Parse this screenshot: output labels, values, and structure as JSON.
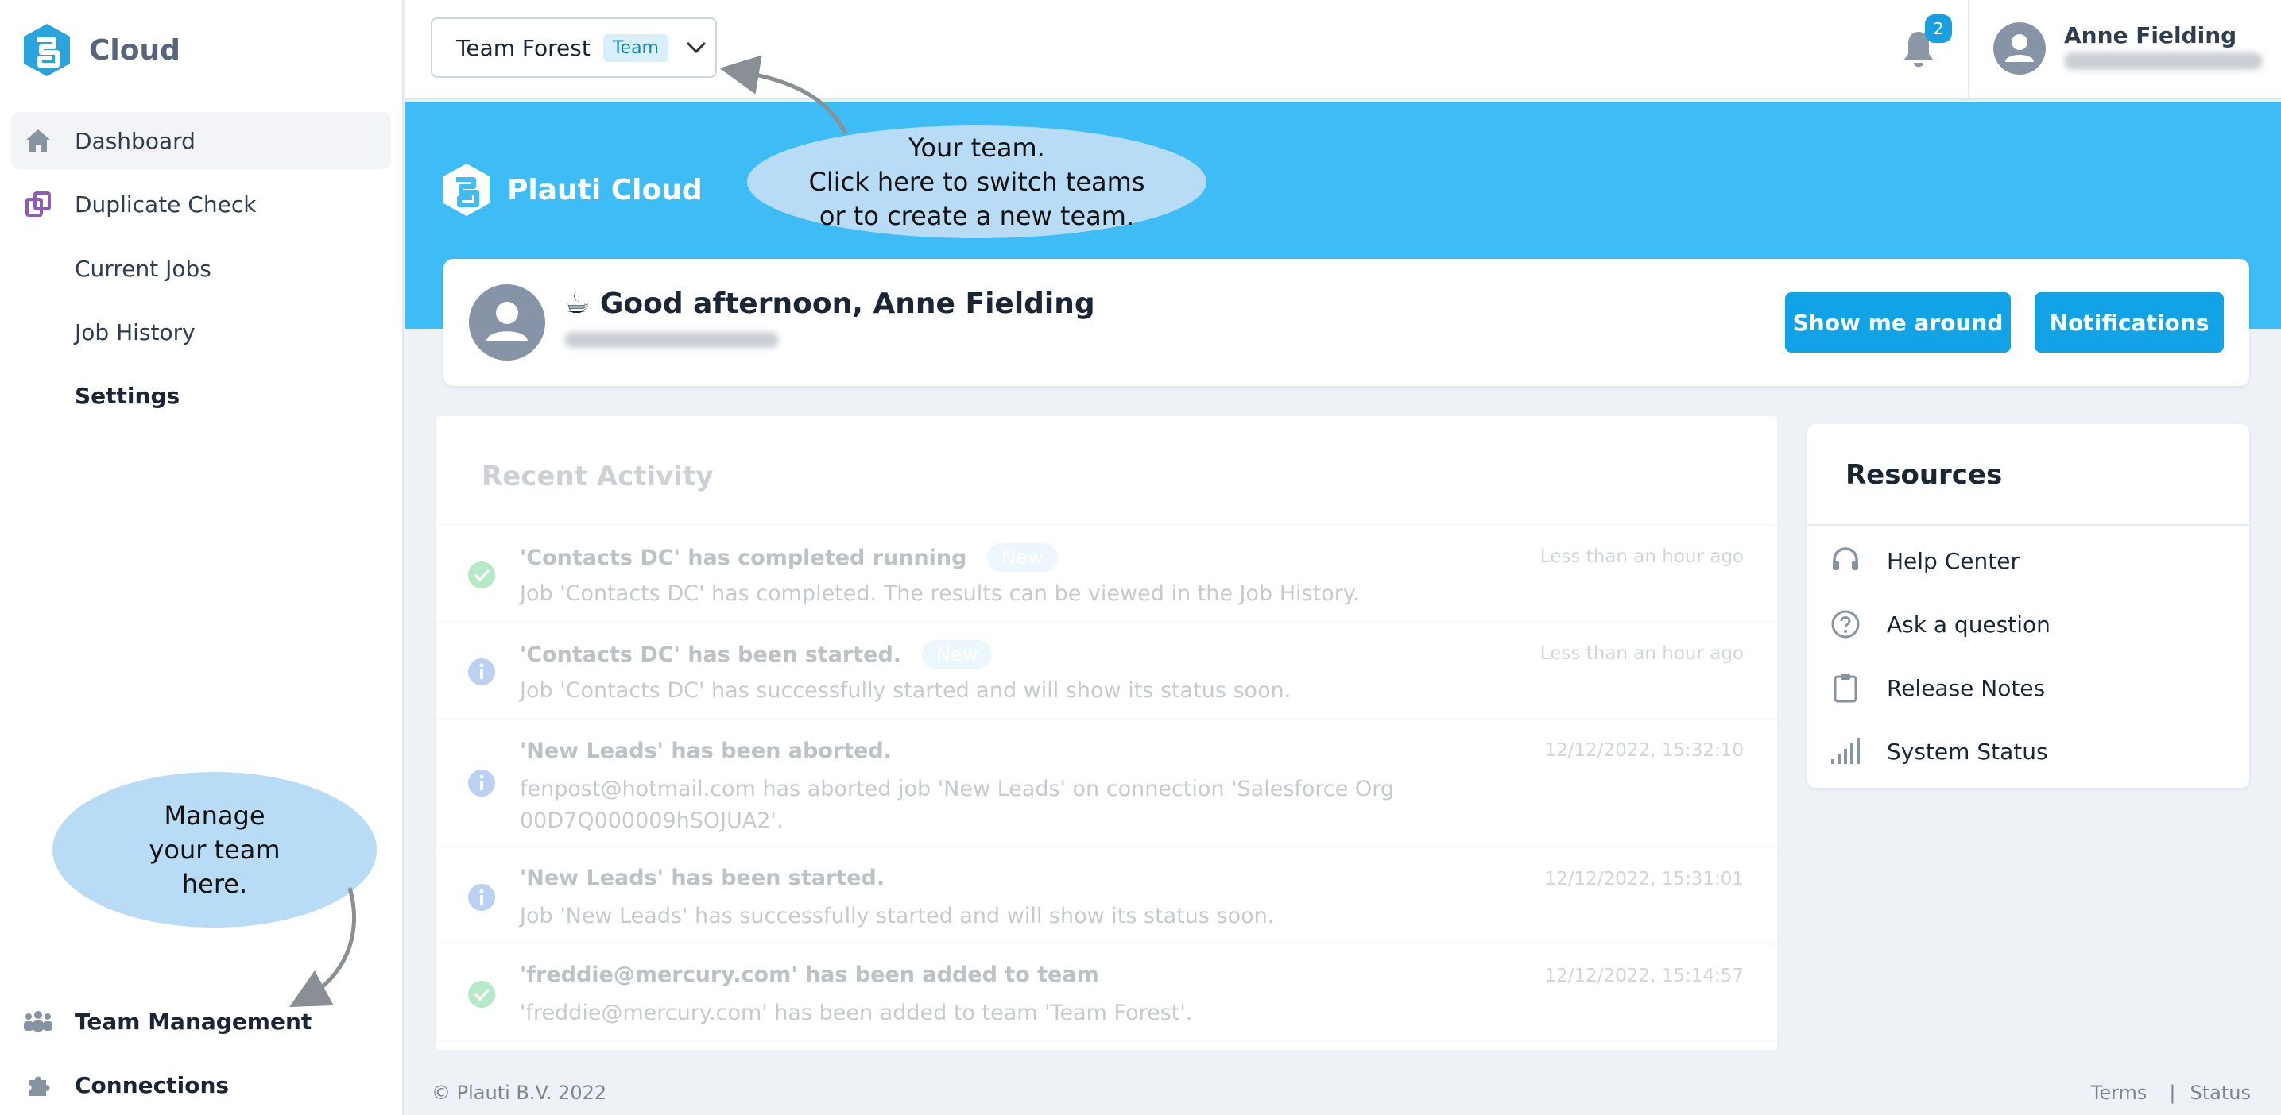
{
  "sidebar": {
    "brand": "Cloud",
    "nav": [
      {
        "label": "Dashboard",
        "icon": "home-icon",
        "active": true
      },
      {
        "label": "Duplicate Check",
        "icon": "duplicate-check-icon"
      }
    ],
    "sub_items": [
      {
        "label": "Current Jobs"
      },
      {
        "label": "Job History"
      },
      {
        "label": "Settings"
      }
    ],
    "bottom": [
      {
        "label": "Team Management",
        "icon": "team-icon"
      },
      {
        "label": "Connections",
        "icon": "puzzle-icon"
      }
    ]
  },
  "topbar": {
    "team_name": "Team Forest",
    "team_badge": "Team",
    "notification_count": "2",
    "user_name": "Anne Fielding"
  },
  "hero": {
    "brand": "Plauti Cloud"
  },
  "greeting": {
    "emoji": "☕",
    "text": "Good afternoon, Anne Fielding",
    "show_me_around": "Show me around",
    "notifications": "Notifications"
  },
  "activity": {
    "title": "Recent Activity",
    "items": [
      {
        "status": "success",
        "title": "'Contacts DC' has completed running",
        "badge": "New",
        "body": "Job 'Contacts DC' has completed. The results can be viewed in the Job History.",
        "time": "Less than an hour ago"
      },
      {
        "status": "info",
        "title": "'Contacts DC' has been started.",
        "badge": "New",
        "body": "Job 'Contacts DC' has successfully started and will show its status soon.",
        "time": "Less than an hour ago"
      },
      {
        "status": "info",
        "title": "'New Leads' has been aborted.",
        "badge": "",
        "body": "fenpost@hotmail.com has aborted job 'New Leads' on connection 'Salesforce Org 00D7Q000009hSOJUA2'.",
        "time": "12/12/2022, 15:32:10"
      },
      {
        "status": "info",
        "title": "'New Leads' has been started.",
        "badge": "",
        "body": "Job 'New Leads' has successfully started and will show its status soon.",
        "time": "12/12/2022, 15:31:01"
      },
      {
        "status": "success",
        "title": "'freddie@mercury.com' has been added to team",
        "badge": "",
        "body": "'freddie@mercury.com' has been added to team 'Team Forest'.",
        "time": "12/12/2022, 15:14:57"
      }
    ]
  },
  "resources": {
    "title": "Resources",
    "items": [
      {
        "label": "Help Center",
        "icon": "headset-icon"
      },
      {
        "label": "Ask a question",
        "icon": "question-circle-icon"
      },
      {
        "label": "Release Notes",
        "icon": "clipboard-icon"
      },
      {
        "label": "System Status",
        "icon": "signal-bars-icon"
      }
    ]
  },
  "footer": {
    "copyright": "© Plauti B.V. 2022",
    "terms": "Terms",
    "separator": "|",
    "status": "Status"
  },
  "tooltips": {
    "team": "Your team.\nClick here to switch teams\nor to create a new team.",
    "manage": "Manage\nyour team\nhere."
  },
  "colors": {
    "accent": "#12a2e6",
    "hero": "#3dbcf5",
    "bubble": "#b8dcf5",
    "success": "#2fbf5a",
    "info": "#3b7de0"
  }
}
